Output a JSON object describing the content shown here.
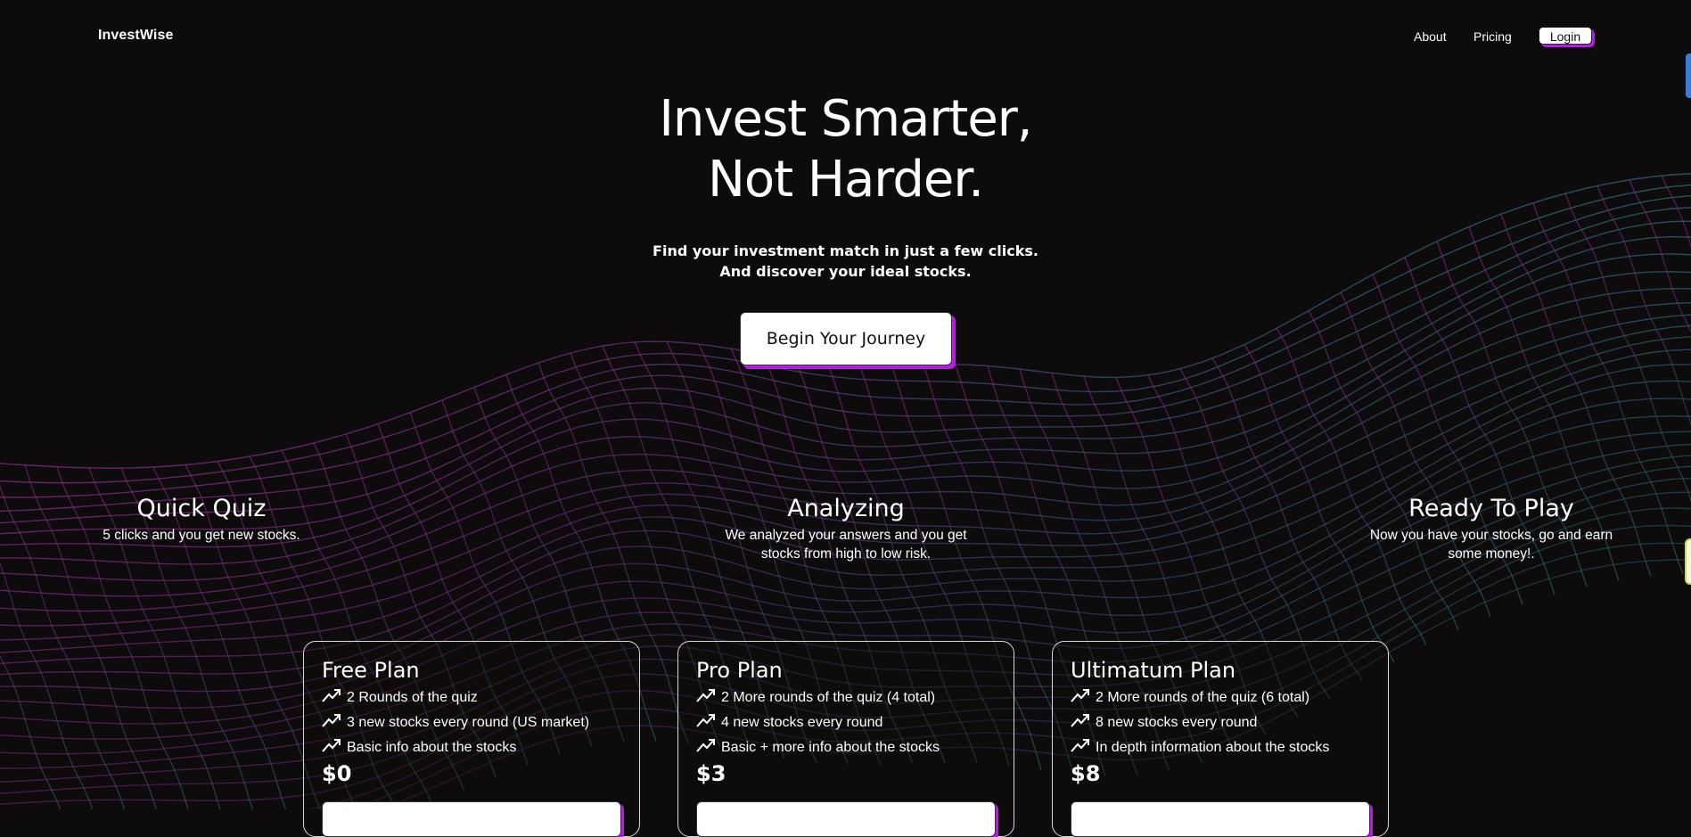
{
  "nav": {
    "brand": "InvestWise",
    "links": [
      "About",
      "Pricing"
    ],
    "login_label": "Login"
  },
  "hero": {
    "title_line1": "Invest Smarter,",
    "title_line2": "Not Harder.",
    "subtitle_line1": "Find your investment match in just a few clicks.",
    "subtitle_line2": "And discover your ideal stocks.",
    "cta_label": "Begin Your Journey"
  },
  "features": [
    {
      "title": "Quick Quiz",
      "text": "5 clicks and you get new stocks."
    },
    {
      "title": "Analyzing",
      "text": "We analyzed your answers and you get stocks from high to low risk."
    },
    {
      "title": "Ready To Play",
      "text": "Now you have your stocks, go and earn some money!."
    }
  ],
  "plans": [
    {
      "name": "Free Plan",
      "features": [
        "2 Rounds of the quiz",
        "3 new stocks every round (US market)",
        "Basic info about the stocks"
      ],
      "price": "$0"
    },
    {
      "name": "Pro Plan",
      "features": [
        "2 More rounds of the quiz (4 total)",
        "4 new stocks every round",
        "Basic + more info about the stocks"
      ],
      "price": "$3"
    },
    {
      "name": "Ultimatum Plan",
      "features": [
        "2 More rounds of the quiz (6 total)",
        "8 new stocks every round",
        "In depth information about the stocks"
      ],
      "price": "$8"
    }
  ],
  "icons": {
    "feature_bullet": "trending-up-icon"
  },
  "colors": {
    "background": "#0e0b0c",
    "accent_shadow": "#b21de0",
    "wave_magenta": "#8a2a86",
    "wave_teal": "#2d6f78"
  }
}
